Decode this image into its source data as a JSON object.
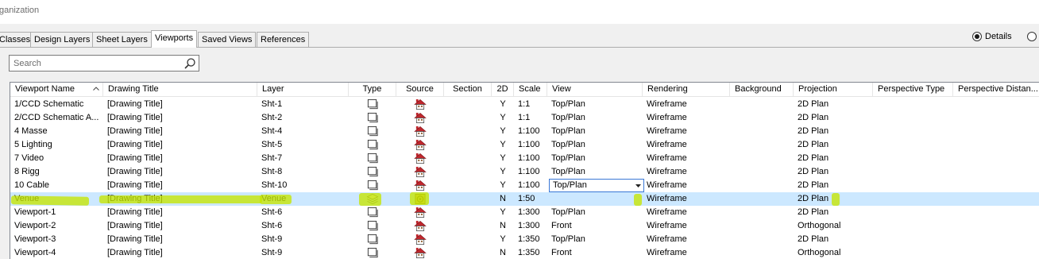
{
  "window": {
    "title_fragment": "ganization"
  },
  "tabs": [
    "Classes",
    "Design Layers",
    "Sheet Layers",
    "Viewports",
    "Saved Views",
    "References"
  ],
  "active_tab": "Viewports",
  "view_options": {
    "details_label": "Details",
    "details_selected": true
  },
  "search": {
    "placeholder": "Search",
    "value": ""
  },
  "table": {
    "columns": [
      "Viewport Name",
      "Drawing Title",
      "Layer",
      "Type",
      "Source",
      "Section",
      "2D",
      "Scale",
      "View",
      "Rendering",
      "Background",
      "Projection",
      "Perspective Type",
      "Perspective Distan..."
    ],
    "sort_column": "Viewport Name",
    "sort_direction": "ascending",
    "selected_row": 7,
    "rows": [
      {
        "name": "1/CCD Schematic",
        "title": "[Drawing Title]",
        "layer": "Sht-1",
        "type": "sheet-viewport-icon",
        "source": "house-icon",
        "section": "",
        "twod": "Y",
        "scale": "1:1",
        "view": "Top/Plan",
        "rendering": "Wireframe",
        "background": "",
        "projection": "2D Plan",
        "ptype": "",
        "pdist": ""
      },
      {
        "name": "2/CCD Schematic A...",
        "title": "[Drawing Title]",
        "layer": "Sht-2",
        "type": "sheet-viewport-icon",
        "source": "house-icon",
        "section": "",
        "twod": "Y",
        "scale": "1:1",
        "view": "Top/Plan",
        "rendering": "Wireframe",
        "background": "",
        "projection": "2D Plan",
        "ptype": "",
        "pdist": ""
      },
      {
        "name": "4 Masse",
        "title": "[Drawing Title]",
        "layer": "Sht-4",
        "type": "sheet-viewport-icon",
        "source": "house-icon",
        "section": "",
        "twod": "Y",
        "scale": "1:100",
        "view": "Top/Plan",
        "rendering": "Wireframe",
        "background": "",
        "projection": "2D Plan",
        "ptype": "",
        "pdist": ""
      },
      {
        "name": "5 Lighting",
        "title": "[Drawing Title]",
        "layer": "Sht-5",
        "type": "sheet-viewport-icon",
        "source": "house-icon",
        "section": "",
        "twod": "Y",
        "scale": "1:100",
        "view": "Top/Plan",
        "rendering": "Wireframe",
        "background": "",
        "projection": "2D Plan",
        "ptype": "",
        "pdist": ""
      },
      {
        "name": "7 Video",
        "title": "[Drawing Title]",
        "layer": "Sht-7",
        "type": "sheet-viewport-icon",
        "source": "house-icon",
        "section": "",
        "twod": "Y",
        "scale": "1:100",
        "view": "Top/Plan",
        "rendering": "Wireframe",
        "background": "",
        "projection": "2D Plan",
        "ptype": "",
        "pdist": ""
      },
      {
        "name": "8 Rigg",
        "title": "[Drawing Title]",
        "layer": "Sht-8",
        "type": "sheet-viewport-icon",
        "source": "house-icon",
        "section": "",
        "twod": "Y",
        "scale": "1:100",
        "view": "Top/Plan",
        "rendering": "Wireframe",
        "background": "",
        "projection": "2D Plan",
        "ptype": "",
        "pdist": ""
      },
      {
        "name": "10 Cable",
        "title": "[Drawing Title]",
        "layer": "Sht-10",
        "type": "sheet-viewport-icon",
        "source": "house-icon",
        "section": "",
        "twod": "Y",
        "scale": "1:100",
        "view": "Top/Plan",
        "rendering": "Wireframe",
        "background": "",
        "projection": "2D Plan",
        "ptype": "",
        "pdist": ""
      },
      {
        "name": "Venue",
        "title": "[Drawing Title]",
        "layer": "Venue",
        "type": "layers-icon",
        "source": "target-icon",
        "section": "",
        "twod": "N",
        "scale": "1:50",
        "view": "",
        "rendering": "Wireframe",
        "background": "",
        "projection": "2D Plan",
        "ptype": "",
        "pdist": ""
      },
      {
        "name": "Viewport-1",
        "title": "[Drawing Title]",
        "layer": "Sht-6",
        "type": "sheet-viewport-icon",
        "source": "house-icon",
        "section": "",
        "twod": "Y",
        "scale": "1:300",
        "view": "Top/Plan",
        "rendering": "Wireframe",
        "background": "",
        "projection": "2D Plan",
        "ptype": "",
        "pdist": ""
      },
      {
        "name": "Viewport-2",
        "title": "[Drawing Title]",
        "layer": "Sht-6",
        "type": "sheet-viewport-icon",
        "source": "house-icon",
        "section": "",
        "twod": "N",
        "scale": "1:300",
        "view": "Front",
        "rendering": "Wireframe",
        "background": "",
        "projection": "Orthogonal",
        "ptype": "",
        "pdist": ""
      },
      {
        "name": "Viewport-3",
        "title": "[Drawing Title]",
        "layer": "Sht-9",
        "type": "sheet-viewport-icon",
        "source": "house-icon",
        "section": "",
        "twod": "Y",
        "scale": "1:350",
        "view": "Top/Plan",
        "rendering": "Wireframe",
        "background": "",
        "projection": "2D Plan",
        "ptype": "",
        "pdist": ""
      },
      {
        "name": "Viewport-4",
        "title": "[Drawing Title]",
        "layer": "Sht-9",
        "type": "sheet-viewport-icon",
        "source": "house-icon",
        "section": "",
        "twod": "N",
        "scale": "1:350",
        "view": "Front",
        "rendering": "Wireframe",
        "background": "",
        "projection": "Orthogonal",
        "ptype": "",
        "pdist": ""
      }
    ],
    "view_dropdown": {
      "row": 6,
      "value": "Top/Plan"
    }
  },
  "colors": {
    "selection": "#cce8ff",
    "highlighter": "#c5e600",
    "house_roof": "#c0272d"
  }
}
